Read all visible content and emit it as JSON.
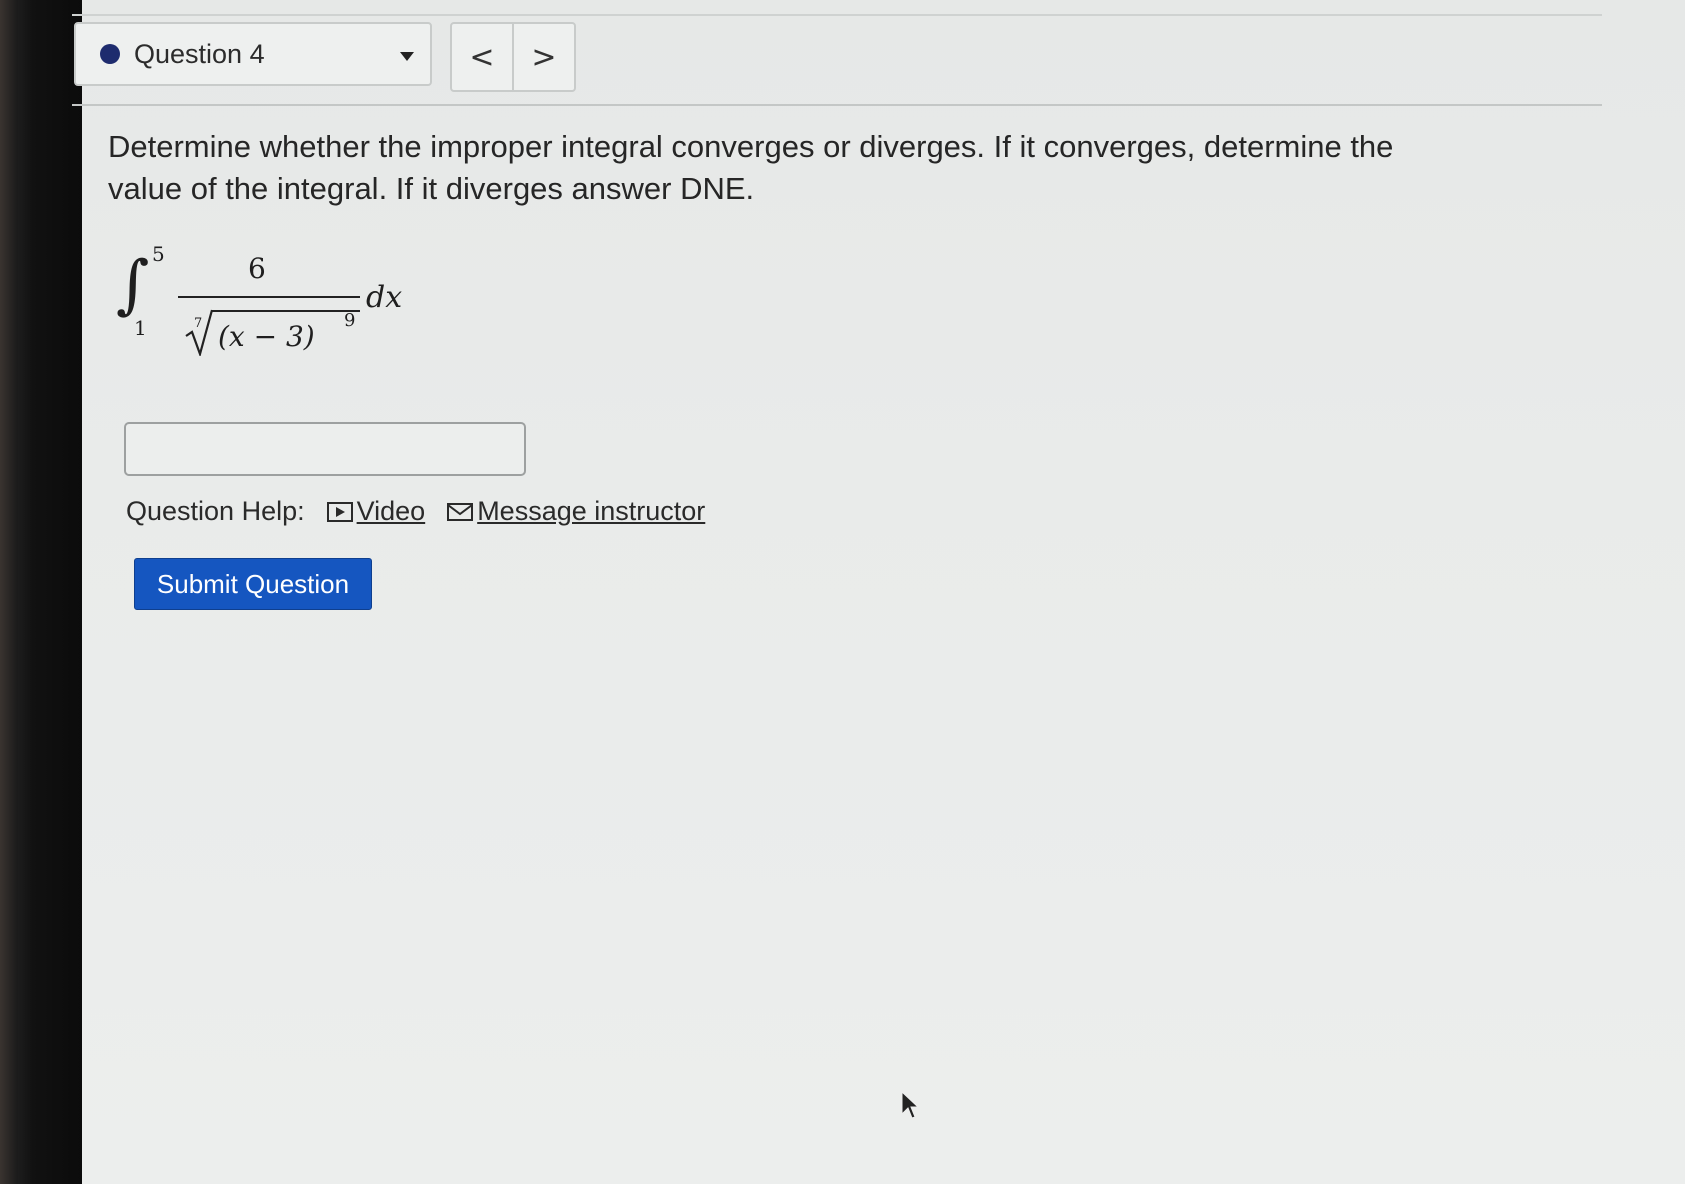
{
  "question_selector": {
    "label": "Question 4",
    "status_color": "#1e2c6e"
  },
  "nav": {
    "prev_label": "<",
    "next_label": ">"
  },
  "prompt": {
    "text": "Determine whether the improper integral converges or diverges. If it converges, determine the value of the integral. If it diverges answer DNE."
  },
  "math": {
    "integral_sign": "∫",
    "upper_limit": "5",
    "lower_limit": "1",
    "numerator": "6",
    "root_index": "7",
    "radicand": "(x − 3)",
    "exponent": "9",
    "differential": "dx"
  },
  "answer": {
    "value": ""
  },
  "help": {
    "label": "Question Help:",
    "video_label": "Video",
    "message_label": "Message instructor",
    "video_icon": "video-play-icon",
    "message_icon": "envelope-icon"
  },
  "submit": {
    "label": "Submit Question",
    "color": "#1556c0"
  }
}
